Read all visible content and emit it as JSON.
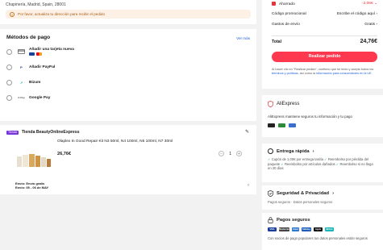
{
  "address": {
    "line": "Chapinería, Madrid, Spain, 28001",
    "warning": "Por favor, actualiza tu dirección para recibir el pedido"
  },
  "payment": {
    "title": "Métodos de pago",
    "see_all": "Ver más",
    "methods": [
      {
        "label": "Añadir una tarjeta nueva",
        "icon": "credit-card-icon"
      },
      {
        "label": "Añadir PayPal",
        "icon": "paypal-icon"
      },
      {
        "label": "Bizum",
        "icon": "bizum-icon"
      },
      {
        "label": "Google Pay",
        "icon": "google-pay-icon"
      }
    ]
  },
  "store": {
    "badge": "Tienda",
    "name": "Tienda BeautyOnlineExpress",
    "product_title": "Olaplex In Good Repair Kit N3 50ml, N4 100ml, N5 100ml, N7 30ml",
    "price": "26,76€",
    "quantity": "1",
    "shipping_line1": "Envío: Envío gratis",
    "shipping_line2": "Envío: 05 - 06 de MAY"
  },
  "summary": {
    "saved_label": "Ahorrado",
    "saved_value": "-2,06€",
    "promo_label": "Código promocional",
    "promo_value": "Escribe el código aquí",
    "shipping_label": "Gastos de envío",
    "shipping_value": "Gratis",
    "total_label": "Total",
    "total_value": "24,76€",
    "order_button": "Realizar pedido",
    "legal_prefix": "Al hacer clic en \"Realizar pedido\", confirmo que he leído y acepto todos los ",
    "legal_link1": "términos y políticas",
    "legal_mid": ", así como la ",
    "legal_link2": "información para consumidores en la UE",
    "legal_suffix": "."
  },
  "aliexpress": {
    "brand": "AliExpress",
    "text": "AliExpress mantiene seguros tu información y tu pago"
  },
  "fast_delivery": {
    "title": "Entrega rápida",
    "item1": "Cupón de 1,00€ por entrega tardía",
    "item2": "Reembolso por pérdida del paquete",
    "item3": "Reembolso por artículos dañados",
    "item4": "Reembolso si no llega en 20 días"
  },
  "security": {
    "title": "Seguridad & Privacidad",
    "subtitle": "Pagos seguros · Datos personales seguros"
  },
  "secure_payments": {
    "title": "Pagos seguros",
    "logos": [
      "VISA",
      "Mastercard",
      "Amex",
      "Safekey",
      "Apple Pay",
      "Bizum"
    ],
    "text": "Con socios de pago populares tus datos personales están seguros"
  },
  "colors": {
    "accent": "#fd384f",
    "link": "#1a5dd6",
    "success": "#1d9e4c"
  }
}
